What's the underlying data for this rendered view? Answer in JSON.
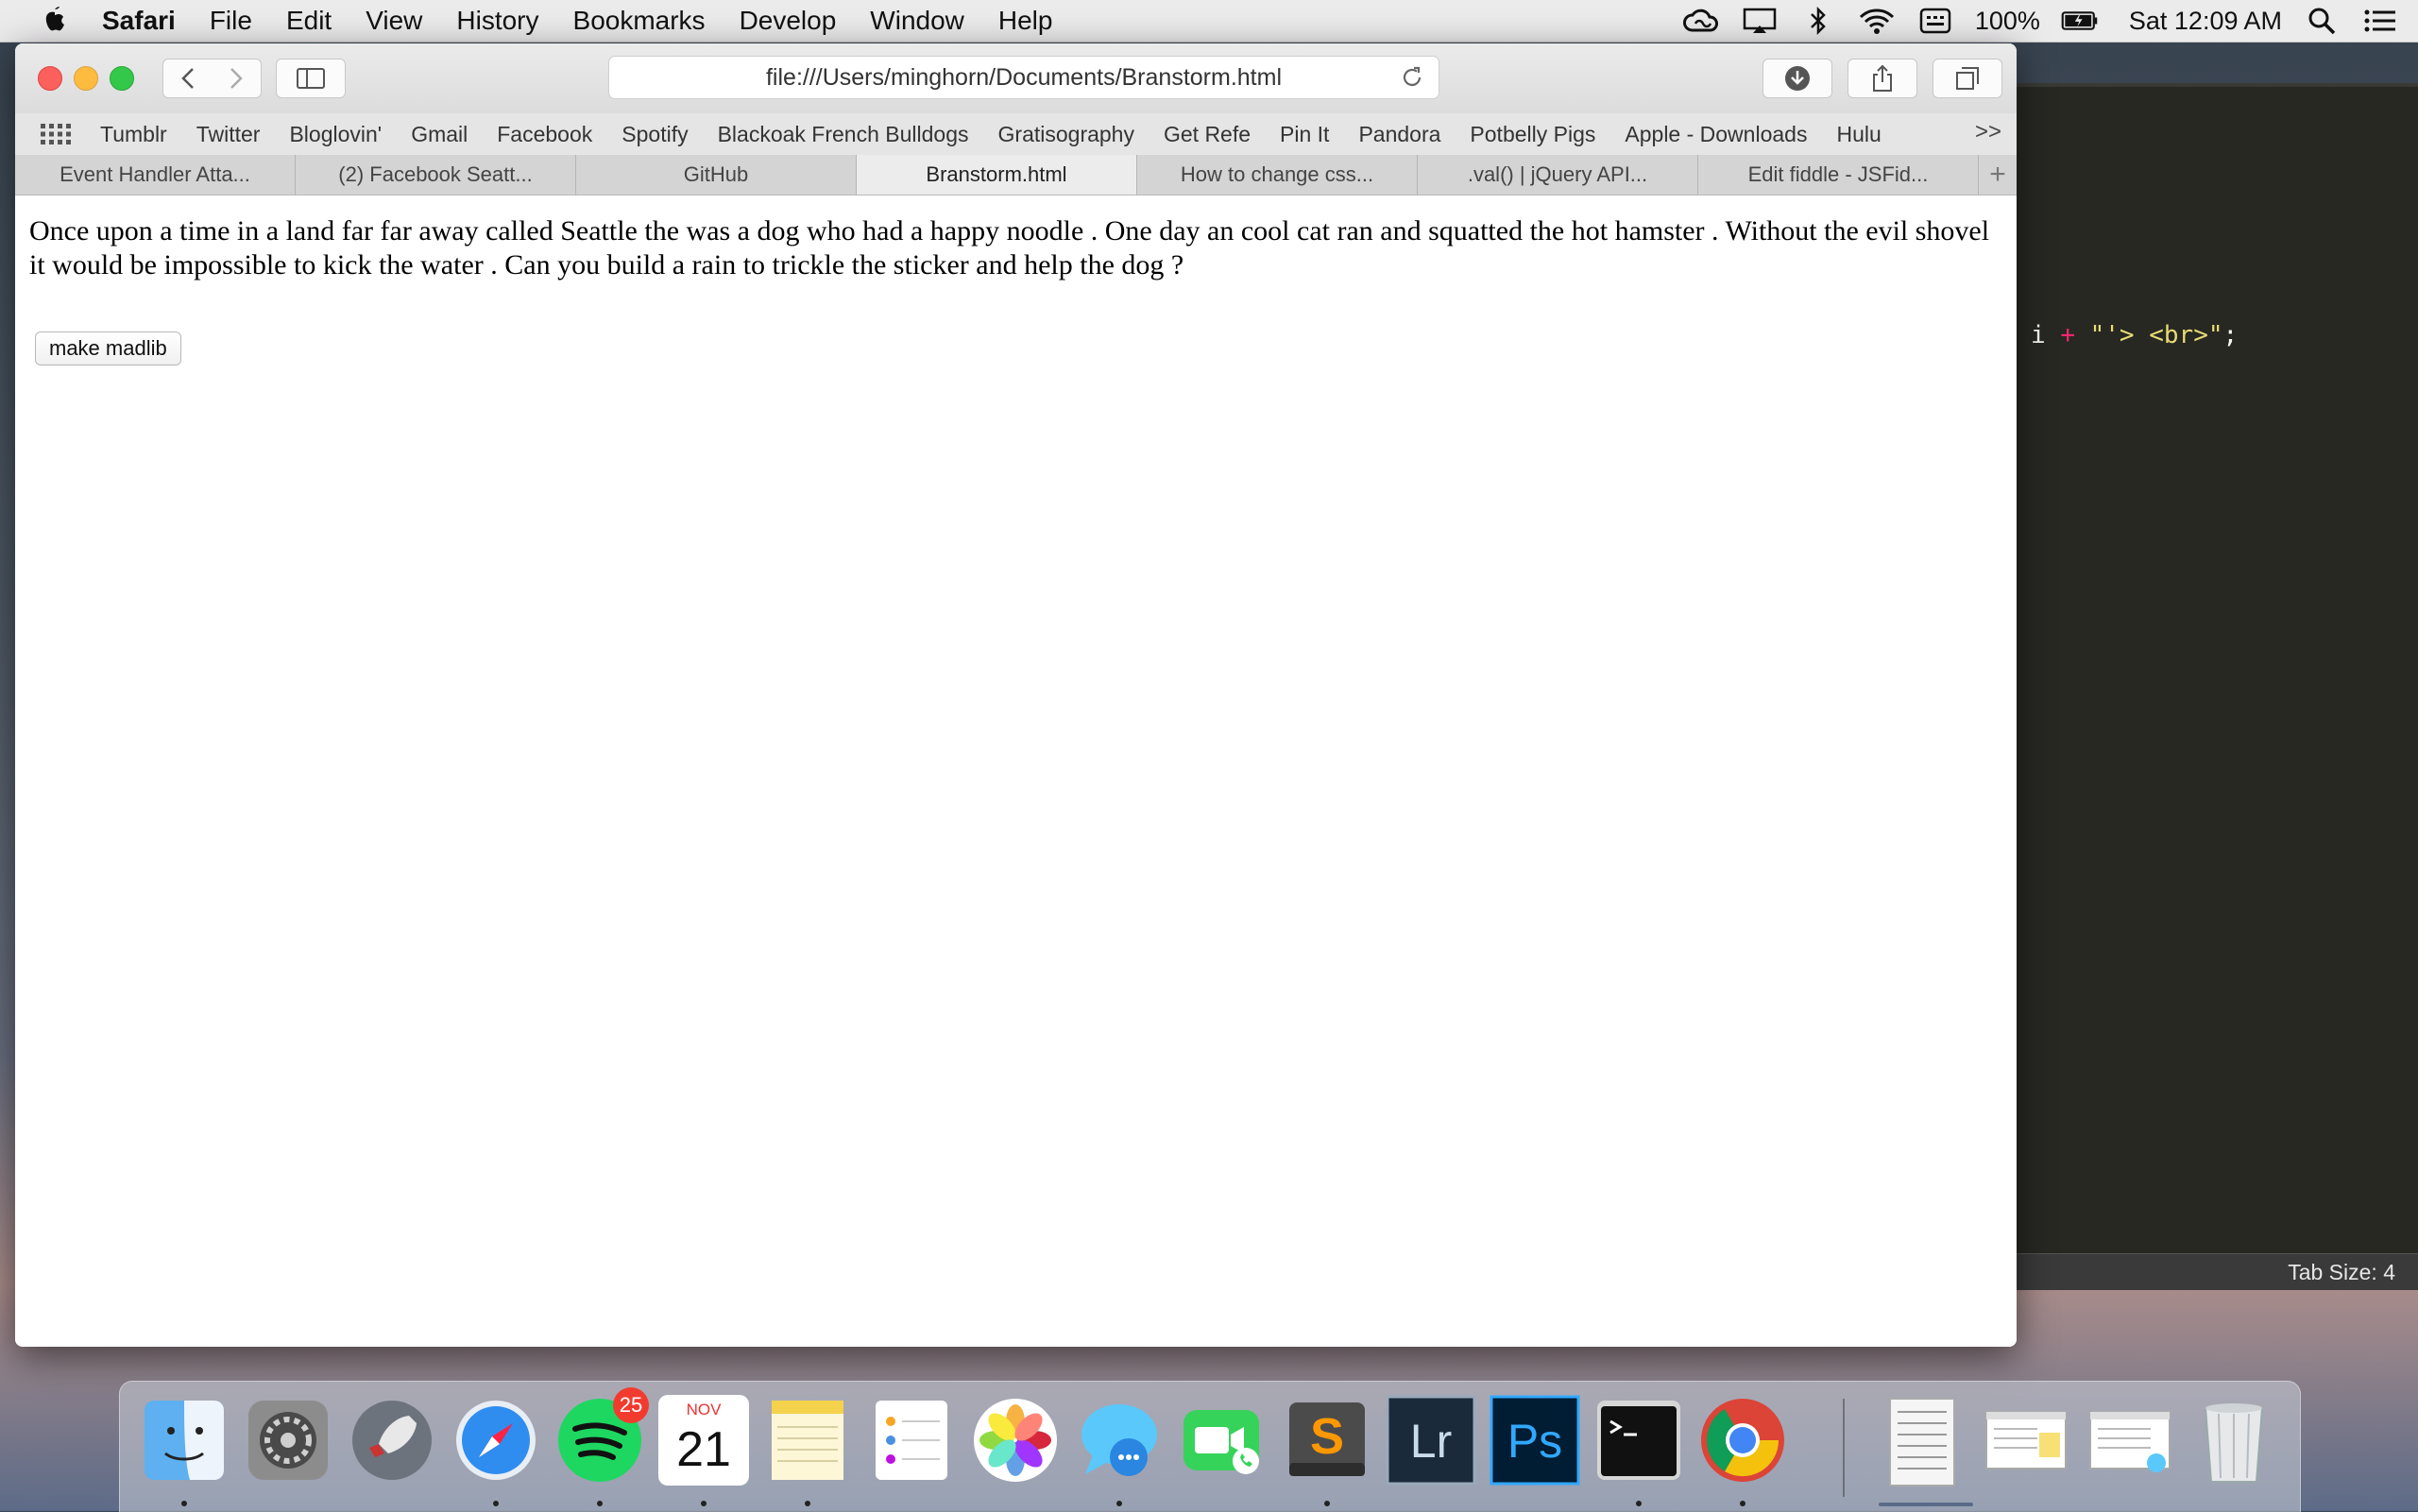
{
  "menubar": {
    "app": "Safari",
    "items": [
      "File",
      "Edit",
      "View",
      "History",
      "Bookmarks",
      "Develop",
      "Window",
      "Help"
    ],
    "battery": "100%",
    "clock": "Sat 12:09 AM"
  },
  "browser": {
    "url": "file:///Users/minghorn/Documents/Branstorm.html",
    "bookmarks": [
      "Tumblr",
      "Twitter",
      "Bloglovin'",
      "Gmail",
      "Facebook",
      "Spotify",
      "Blackoak French Bulldogs",
      "Gratisography",
      "Get Refe",
      "Pin It",
      "Pandora",
      "Potbelly Pigs",
      "Apple - Downloads",
      "Hulu"
    ],
    "bookmarks_more": ">>",
    "tabs": [
      "Event Handler Atta...",
      "(2) Facebook Seatt...",
      "GitHub",
      "Branstorm.html",
      "How to change css...",
      ".val() | jQuery API...",
      "Edit fiddle - JSFid..."
    ],
    "active_tab_index": 3,
    "tab_add": "+"
  },
  "page": {
    "story": "Once upon a time in a land far far away called Seattle the was a dog who had a happy noodle . One day an cool cat ran and squatted the hot hamster . Without the evil shovel it would be impossible to kick the water . Can you build a rain to trickle the sticker and help the dog ?",
    "button_label": "make madlib"
  },
  "editor": {
    "code_var": "i",
    "code_op": "+",
    "code_str": "\"'> <br>\"",
    "code_end": ";",
    "status": "Tab Size: 4"
  },
  "dock": {
    "apps": [
      "Finder",
      "System Preferences",
      "Launchpad",
      "Safari",
      "Spotify",
      "Calendar",
      "Notes",
      "Reminders",
      "Photos",
      "Messages",
      "FaceTime",
      "Sublime Text",
      "Lightroom",
      "Photoshop",
      "Terminal",
      "Chrome"
    ],
    "spotify_badge": "25",
    "calendar_month": "NOV",
    "calendar_day": "21"
  },
  "colors": {
    "editor_bg": "#272822",
    "close": "#fc605c",
    "minimize": "#fdbc40",
    "zoom": "#34c84a"
  }
}
